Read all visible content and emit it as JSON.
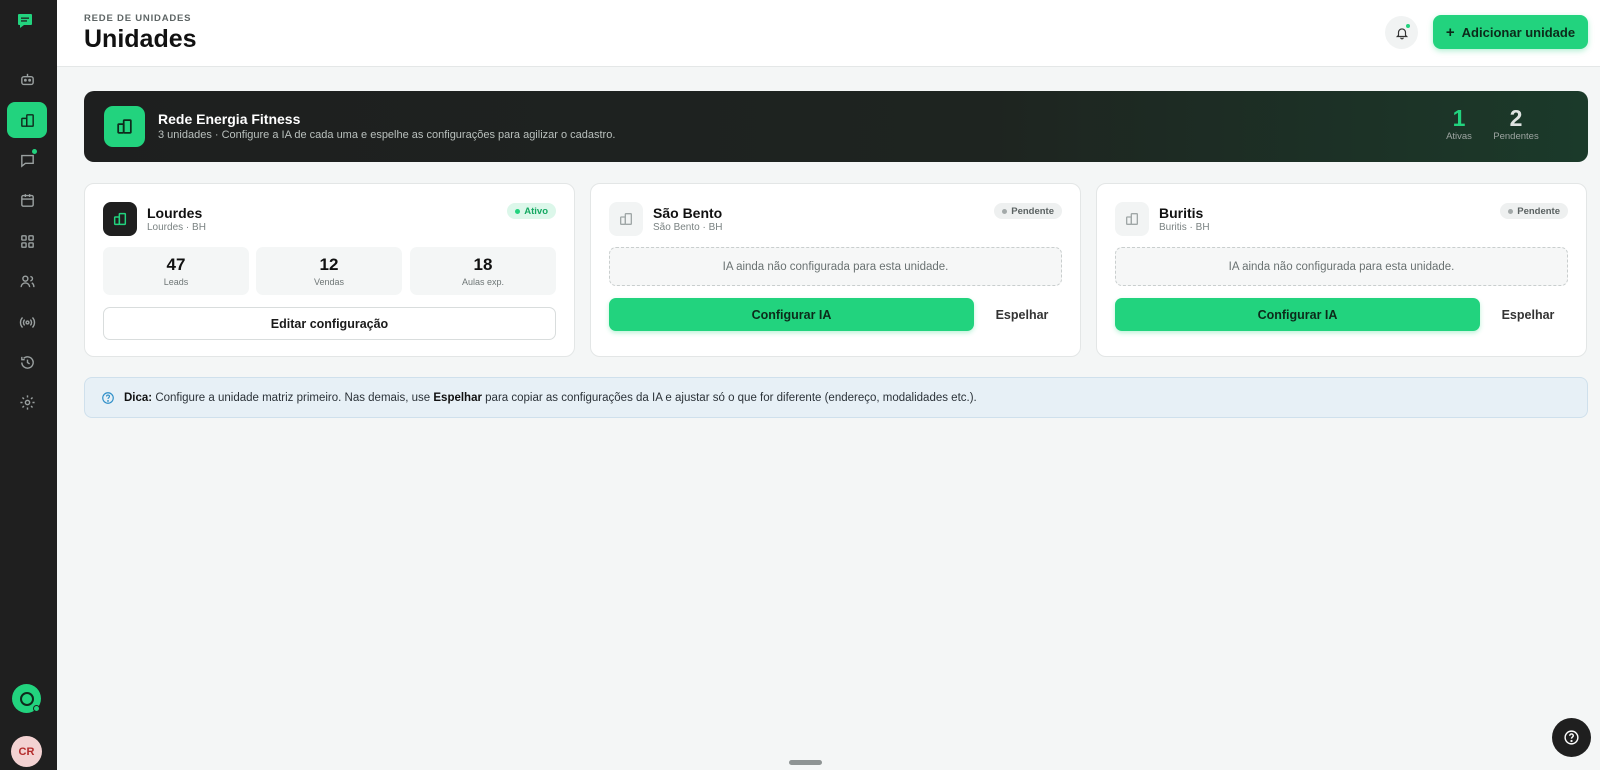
{
  "sidebar": {
    "items": [
      {
        "icon": "bot-icon",
        "active": false
      },
      {
        "icon": "building-icon",
        "active": true
      },
      {
        "icon": "chat-icon",
        "active": false,
        "dot": true
      },
      {
        "icon": "calendar-icon",
        "active": false
      },
      {
        "icon": "apps-icon",
        "active": false
      },
      {
        "icon": "users-icon",
        "active": false
      },
      {
        "icon": "broadcast-icon",
        "active": false
      },
      {
        "icon": "history-icon",
        "active": false
      },
      {
        "icon": "settings-icon",
        "active": false
      }
    ],
    "avatar_initials": "CR"
  },
  "header": {
    "eyebrow": "REDE DE UNIDADES",
    "title": "Unidades",
    "add_button": "Adicionar unidade"
  },
  "network": {
    "name": "Rede Energia Fitness",
    "subtitle": "3 unidades · Configure a IA de cada uma e espelhe as configurações para agilizar o cadastro.",
    "active_count": "1",
    "active_label": "Ativas",
    "pending_count": "2",
    "pending_label": "Pendentes"
  },
  "units": [
    {
      "name": "Lourdes",
      "location": "Lourdes · BH",
      "status": "Ativo",
      "metrics": [
        {
          "value": "47",
          "label": "Leads"
        },
        {
          "value": "12",
          "label": "Vendas"
        },
        {
          "value": "18",
          "label": "Aulas exp."
        }
      ],
      "edit_button": "Editar configuração"
    },
    {
      "name": "São Bento",
      "location": "São Bento · BH",
      "status": "Pendente",
      "empty_text": "IA ainda não configurada para esta unidade.",
      "config_button": "Configurar IA",
      "mirror_button": "Espelhar"
    },
    {
      "name": "Buritis",
      "location": "Buritis · BH",
      "status": "Pendente",
      "empty_text": "IA ainda não configurada para esta unidade.",
      "config_button": "Configurar IA",
      "mirror_button": "Espelhar"
    }
  ],
  "tip": {
    "label": "Dica:",
    "text_1": " Configure a unidade matriz primeiro. Nas demais, use ",
    "emphasis": "Espelhar",
    "text_2": " para copiar as configurações da IA e ajustar só o que for diferente (endereço, modalidades etc.)."
  },
  "colors": {
    "accent": "#22d37e",
    "sidebar_bg": "#1f1f1f",
    "tip_bg": "#e7f0f6"
  }
}
